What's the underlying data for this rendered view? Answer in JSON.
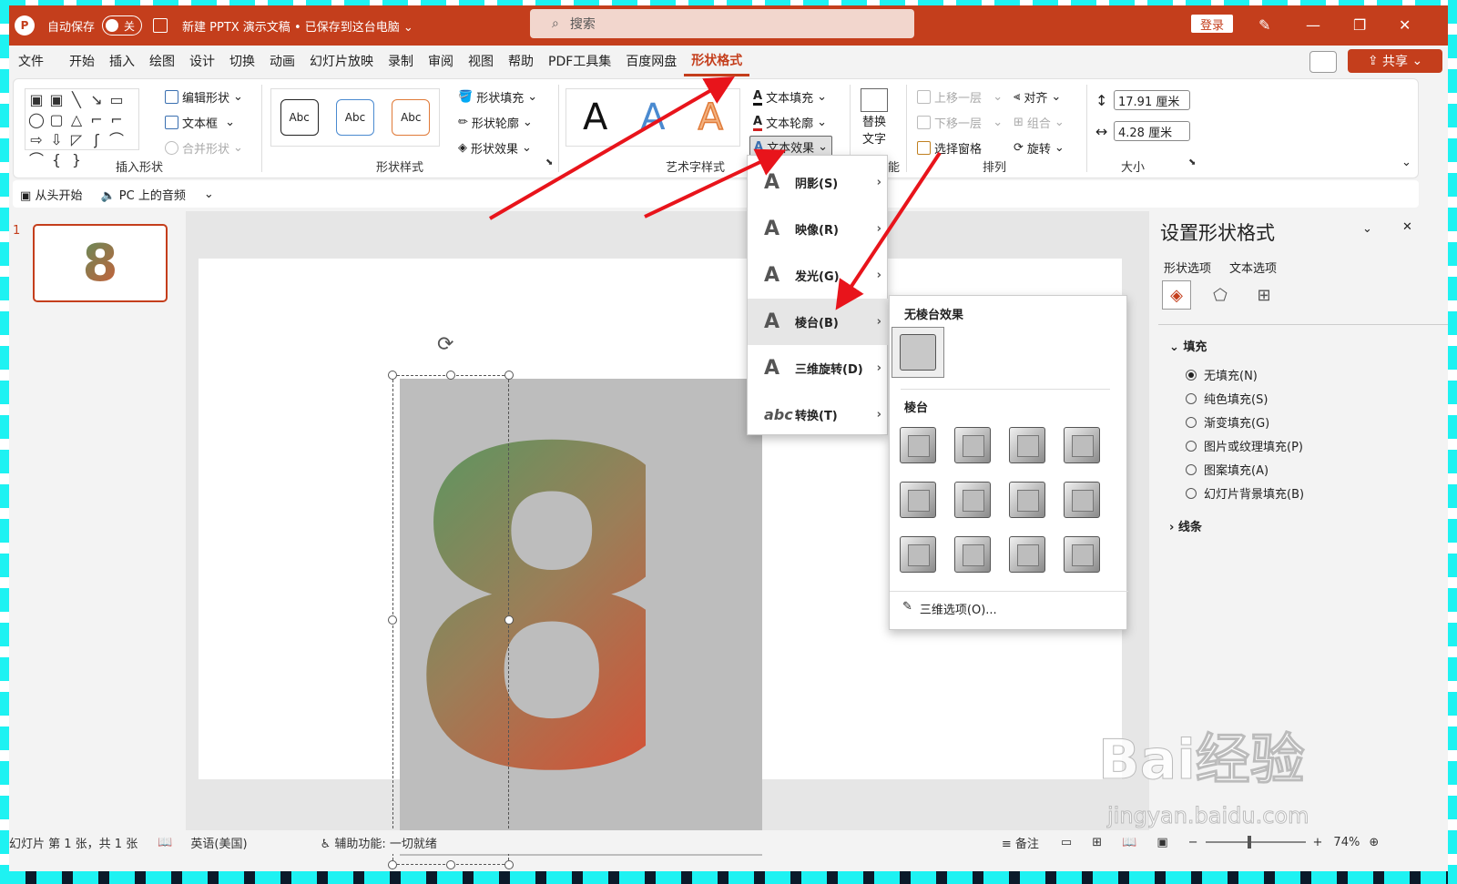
{
  "titlebar": {
    "autosave_label": "自动保存",
    "toggle_label": "关",
    "doc_title": "新建 PPTX 演示文稿 • 已保存到这台电脑 ⌄",
    "search_placeholder": "搜索",
    "login_label": "登录"
  },
  "menu": {
    "tabs": [
      "文件",
      "开始",
      "插入",
      "绘图",
      "设计",
      "切换",
      "动画",
      "幻灯片放映",
      "录制",
      "审阅",
      "视图",
      "帮助",
      "PDF工具集",
      "百度网盘",
      "形状格式"
    ],
    "share_label": "共享"
  },
  "ribbon": {
    "insert_shape": {
      "label": "插入形状",
      "edit_shape": "编辑形状",
      "text_box": "文本框",
      "merge_shape": "合并形状"
    },
    "shape_styles": {
      "label": "形状样式",
      "abc": "Abc",
      "fill": "形状填充",
      "outline": "形状轮廓",
      "effect": "形状效果"
    },
    "art_text": {
      "label": "艺术字样式",
      "letter": "A",
      "fill": "文本填充",
      "outline": "文本轮廓",
      "effect": "文本效果"
    },
    "alt_text": {
      "line1": "替换",
      "line2": "文字",
      "label_fragment": "能"
    },
    "arrange": {
      "label": "排列",
      "bring_forward": "上移一层",
      "send_backward": "下移一层",
      "selection_pane": "选择窗格",
      "align": "对齐",
      "group": "组合",
      "rotate": "旋转"
    },
    "size": {
      "label": "大小",
      "height": "17.91 厘米",
      "width": "4.28 厘米"
    }
  },
  "qat": {
    "from_start": "从头开始",
    "audio": "PC 上的音频"
  },
  "slide": {
    "thumb_number": "1",
    "digit": "8"
  },
  "dropdown": {
    "items": [
      {
        "label": "阴影(S)",
        "icon": "A"
      },
      {
        "label": "映像(R)",
        "icon": "A"
      },
      {
        "label": "发光(G)",
        "icon": "A"
      },
      {
        "label": "棱台(B)",
        "icon": "A"
      },
      {
        "label": "三维旋转(D)",
        "icon": "A"
      },
      {
        "label": "转换(T)",
        "icon": "abc"
      }
    ]
  },
  "submenu": {
    "no_bevel": "无棱台效果",
    "bevel": "棱台",
    "options": "三维选项(O)..."
  },
  "format_pane": {
    "title": "设置形状格式",
    "tab1": "形状选项",
    "tab2": "文本选项",
    "fill_section": "填充",
    "fill_options": [
      "无填充(N)",
      "纯色填充(S)",
      "渐变填充(G)",
      "图片或纹理填充(P)",
      "图案填充(A)",
      "幻灯片背景填充(B)"
    ],
    "selected_fill_index": 0,
    "line_section": "线条"
  },
  "status": {
    "slide_info": "幻灯片 第 1 张，共 1 张",
    "language": "英语(美国)",
    "accessibility": "辅助功能: 一切就绪",
    "notes": "备注",
    "zoom": "74%"
  },
  "watermark": {
    "brand": "Bai经验",
    "url": "jingyan.baidu.com"
  },
  "colors": {
    "accent": "#c43e1c",
    "arrow": "#e8141b"
  }
}
